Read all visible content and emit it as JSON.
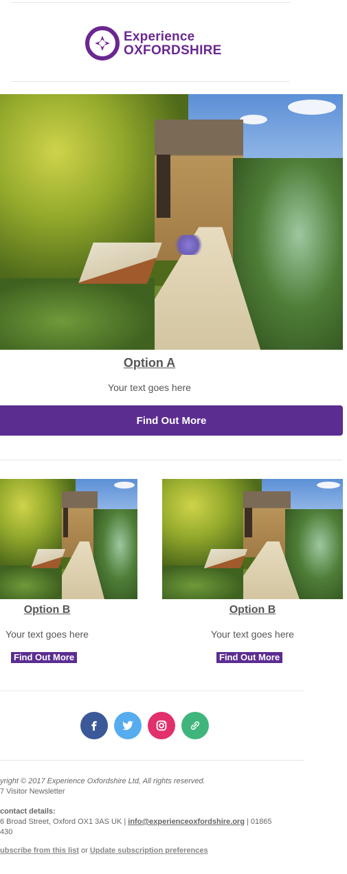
{
  "brand": {
    "logo_line1": "Experience",
    "logo_line2": "OXFORDSHIRE",
    "purple": "#5b2d91"
  },
  "feature": {
    "title": "Option A",
    "text": "Your text goes here",
    "button": "Find Out More"
  },
  "cards": [
    {
      "title": "Option B",
      "text": "Your text goes here",
      "button": "Find Out More"
    },
    {
      "title": "Option B",
      "text": "Your text goes here",
      "button": "Find Out More"
    }
  ],
  "social": [
    {
      "icon": "facebook-icon",
      "color": "#3b5998"
    },
    {
      "icon": "twitter-icon",
      "color": "#55acee"
    },
    {
      "icon": "instagram-icon",
      "color": "#e1306c"
    },
    {
      "icon": "link-icon",
      "color": "#3fb57c"
    }
  ],
  "footer": {
    "copyright": "yright © 2017 Experience Oxfordshire Ltd, All rights reserved.",
    "newsletter": "7 Visitor Newsletter",
    "contact_label": "contact details:",
    "address": "6 Broad Street, Oxford OX1 3AS UK |",
    "email": "info@experienceoxfordshire.org",
    "phone_tail": "| 01865",
    "phone_line2": "430",
    "unsubscribe": "ubscribe from this list",
    "or_text": "or",
    "preferences": "Update subscription preferences"
  }
}
